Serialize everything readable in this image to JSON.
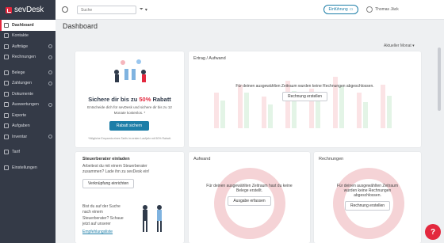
{
  "brand": {
    "name": "sevDesk",
    "accent": "#e3283e",
    "primary": "#1d7ea8"
  },
  "sidebar": {
    "items": [
      {
        "label": "Dashboard",
        "icon": "home-icon"
      },
      {
        "label": "Kontakte",
        "icon": "contacts-icon"
      },
      {
        "label": "Aufträge",
        "icon": "orders-icon"
      },
      {
        "label": "Rechnungen",
        "icon": "invoice-icon"
      },
      {
        "label": "Belege",
        "icon": "receipt-icon"
      },
      {
        "label": "Zahlungen",
        "icon": "payments-icon"
      },
      {
        "label": "Dokumente",
        "icon": "documents-icon"
      },
      {
        "label": "Auswertungen",
        "icon": "reports-icon"
      },
      {
        "label": "Exporte",
        "icon": "export-icon"
      },
      {
        "label": "Aufgaben",
        "icon": "tasks-icon"
      },
      {
        "label": "Inventar",
        "icon": "inventory-icon"
      },
      {
        "label": "Tarif",
        "icon": "tariff-icon"
      },
      {
        "label": "Einstellungen",
        "icon": "settings-icon"
      }
    ]
  },
  "topbar": {
    "search_placeholder": "Suche",
    "onboarding_label": "Einführung",
    "user_name": "Thomas Jäck"
  },
  "main": {
    "title": "Dashboard",
    "period": "Aktueller Monat"
  },
  "promo": {
    "heading_pre": "Sichere dir bis zu ",
    "heading_pct": "50%",
    "heading_post": " Rabatt",
    "text": "Entscheide dich für sevDesk und sichere dir bis zu 12 Monate kostenlos. *",
    "button": "Rabatt sichern",
    "footnote": "*Mögliche Ersparnis eines Tarifs im ersten Laufjahr mit 50% Rabatt."
  },
  "ertrag": {
    "title": "Ertrag / Aufwand",
    "message": "Für deinen ausgewählten Zeitraum wurden keine Rechnungen abgeschlossen.",
    "button": "Rechnung erstellen"
  },
  "steuer": {
    "title": "Steuerberater einladen",
    "text": "Arbeitest du mit einem Steuerberater zusammen? Lade ihn zu sevDesk ein!",
    "button": "Verknüpfung einrichten",
    "search_text": "Bist du auf der Suche nach einem Steuerberater? Schaue jetzt auf unserer",
    "link": "Empfehlungsliste"
  },
  "aufwand": {
    "title": "Aufwand",
    "message": "Für deinen ausgewählten Zeitraum hast du keine Belege erstellt.",
    "button": "Ausgabe erfassen"
  },
  "rechnungen": {
    "title": "Rechnungen",
    "message": "Für deinen ausgewählten Zeitraum wurden keine Rechnungen abgeschlossen.",
    "button": "Rechnung erstellen"
  },
  "help": {
    "label": "?"
  }
}
